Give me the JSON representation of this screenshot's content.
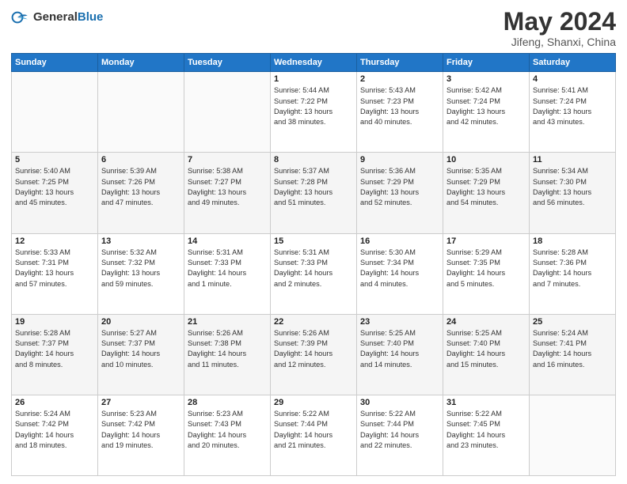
{
  "header": {
    "logo_general": "General",
    "logo_blue": "Blue",
    "month": "May 2024",
    "location": "Jifeng, Shanxi, China"
  },
  "weekdays": [
    "Sunday",
    "Monday",
    "Tuesday",
    "Wednesday",
    "Thursday",
    "Friday",
    "Saturday"
  ],
  "weeks": [
    [
      {
        "day": "",
        "info": ""
      },
      {
        "day": "",
        "info": ""
      },
      {
        "day": "",
        "info": ""
      },
      {
        "day": "1",
        "info": "Sunrise: 5:44 AM\nSunset: 7:22 PM\nDaylight: 13 hours\nand 38 minutes."
      },
      {
        "day": "2",
        "info": "Sunrise: 5:43 AM\nSunset: 7:23 PM\nDaylight: 13 hours\nand 40 minutes."
      },
      {
        "day": "3",
        "info": "Sunrise: 5:42 AM\nSunset: 7:24 PM\nDaylight: 13 hours\nand 42 minutes."
      },
      {
        "day": "4",
        "info": "Sunrise: 5:41 AM\nSunset: 7:24 PM\nDaylight: 13 hours\nand 43 minutes."
      }
    ],
    [
      {
        "day": "5",
        "info": "Sunrise: 5:40 AM\nSunset: 7:25 PM\nDaylight: 13 hours\nand 45 minutes."
      },
      {
        "day": "6",
        "info": "Sunrise: 5:39 AM\nSunset: 7:26 PM\nDaylight: 13 hours\nand 47 minutes."
      },
      {
        "day": "7",
        "info": "Sunrise: 5:38 AM\nSunset: 7:27 PM\nDaylight: 13 hours\nand 49 minutes."
      },
      {
        "day": "8",
        "info": "Sunrise: 5:37 AM\nSunset: 7:28 PM\nDaylight: 13 hours\nand 51 minutes."
      },
      {
        "day": "9",
        "info": "Sunrise: 5:36 AM\nSunset: 7:29 PM\nDaylight: 13 hours\nand 52 minutes."
      },
      {
        "day": "10",
        "info": "Sunrise: 5:35 AM\nSunset: 7:29 PM\nDaylight: 13 hours\nand 54 minutes."
      },
      {
        "day": "11",
        "info": "Sunrise: 5:34 AM\nSunset: 7:30 PM\nDaylight: 13 hours\nand 56 minutes."
      }
    ],
    [
      {
        "day": "12",
        "info": "Sunrise: 5:33 AM\nSunset: 7:31 PM\nDaylight: 13 hours\nand 57 minutes."
      },
      {
        "day": "13",
        "info": "Sunrise: 5:32 AM\nSunset: 7:32 PM\nDaylight: 13 hours\nand 59 minutes."
      },
      {
        "day": "14",
        "info": "Sunrise: 5:31 AM\nSunset: 7:33 PM\nDaylight: 14 hours\nand 1 minute."
      },
      {
        "day": "15",
        "info": "Sunrise: 5:31 AM\nSunset: 7:33 PM\nDaylight: 14 hours\nand 2 minutes."
      },
      {
        "day": "16",
        "info": "Sunrise: 5:30 AM\nSunset: 7:34 PM\nDaylight: 14 hours\nand 4 minutes."
      },
      {
        "day": "17",
        "info": "Sunrise: 5:29 AM\nSunset: 7:35 PM\nDaylight: 14 hours\nand 5 minutes."
      },
      {
        "day": "18",
        "info": "Sunrise: 5:28 AM\nSunset: 7:36 PM\nDaylight: 14 hours\nand 7 minutes."
      }
    ],
    [
      {
        "day": "19",
        "info": "Sunrise: 5:28 AM\nSunset: 7:37 PM\nDaylight: 14 hours\nand 8 minutes."
      },
      {
        "day": "20",
        "info": "Sunrise: 5:27 AM\nSunset: 7:37 PM\nDaylight: 14 hours\nand 10 minutes."
      },
      {
        "day": "21",
        "info": "Sunrise: 5:26 AM\nSunset: 7:38 PM\nDaylight: 14 hours\nand 11 minutes."
      },
      {
        "day": "22",
        "info": "Sunrise: 5:26 AM\nSunset: 7:39 PM\nDaylight: 14 hours\nand 12 minutes."
      },
      {
        "day": "23",
        "info": "Sunrise: 5:25 AM\nSunset: 7:40 PM\nDaylight: 14 hours\nand 14 minutes."
      },
      {
        "day": "24",
        "info": "Sunrise: 5:25 AM\nSunset: 7:40 PM\nDaylight: 14 hours\nand 15 minutes."
      },
      {
        "day": "25",
        "info": "Sunrise: 5:24 AM\nSunset: 7:41 PM\nDaylight: 14 hours\nand 16 minutes."
      }
    ],
    [
      {
        "day": "26",
        "info": "Sunrise: 5:24 AM\nSunset: 7:42 PM\nDaylight: 14 hours\nand 18 minutes."
      },
      {
        "day": "27",
        "info": "Sunrise: 5:23 AM\nSunset: 7:42 PM\nDaylight: 14 hours\nand 19 minutes."
      },
      {
        "day": "28",
        "info": "Sunrise: 5:23 AM\nSunset: 7:43 PM\nDaylight: 14 hours\nand 20 minutes."
      },
      {
        "day": "29",
        "info": "Sunrise: 5:22 AM\nSunset: 7:44 PM\nDaylight: 14 hours\nand 21 minutes."
      },
      {
        "day": "30",
        "info": "Sunrise: 5:22 AM\nSunset: 7:44 PM\nDaylight: 14 hours\nand 22 minutes."
      },
      {
        "day": "31",
        "info": "Sunrise: 5:22 AM\nSunset: 7:45 PM\nDaylight: 14 hours\nand 23 minutes."
      },
      {
        "day": "",
        "info": ""
      }
    ]
  ]
}
